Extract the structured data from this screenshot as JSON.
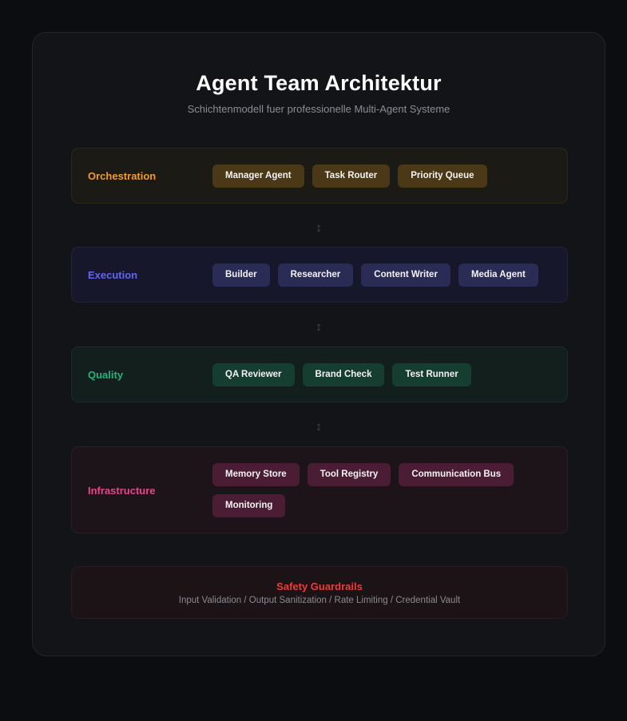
{
  "header": {
    "title": "Agent Team Architektur",
    "subtitle": "Schichtenmodell fuer professionelle Multi-Agent Systeme"
  },
  "layers": [
    {
      "label": "Orchestration",
      "color": "#f39a2b",
      "items": [
        "Manager Agent",
        "Task Router",
        "Priority Queue"
      ]
    },
    {
      "label": "Execution",
      "color": "#6366f1",
      "items": [
        "Builder",
        "Researcher",
        "Content Writer",
        "Media Agent"
      ]
    },
    {
      "label": "Quality",
      "color": "#1fb57c",
      "items": [
        "QA Reviewer",
        "Brand Check",
        "Test Runner"
      ]
    },
    {
      "label": "Infrastructure",
      "color": "#e8458c",
      "items": [
        "Memory Store",
        "Tool Registry",
        "Communication Bus",
        "Monitoring"
      ]
    }
  ],
  "connector": "↕",
  "safety": {
    "title": "Safety Guardrails",
    "description": "Input Validation / Output Sanitization / Rate Limiting / Credential Vault",
    "color": "#ef3b3b"
  }
}
